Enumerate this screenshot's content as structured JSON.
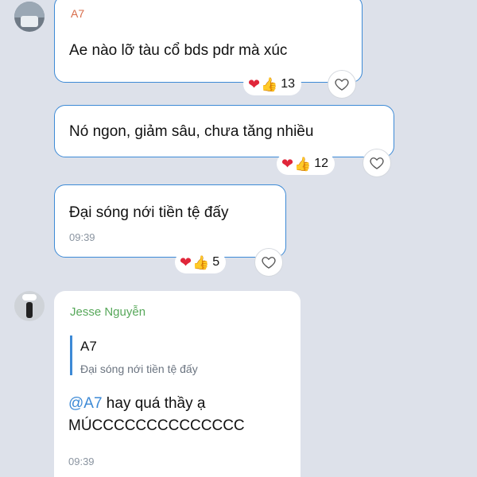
{
  "messages": [
    {
      "sender": "A7",
      "text": "Ae nào lỡ tàu cổ bds pdr mà xúc",
      "reactions": {
        "heart": "❤",
        "thumb": "👍",
        "count": "13"
      }
    },
    {
      "text": "Nó ngon, giảm sâu, chưa tăng nhiều",
      "reactions": {
        "heart": "❤",
        "thumb": "👍",
        "count": "12"
      }
    },
    {
      "text": "Đại sóng nới tiền tệ đấy",
      "time": "09:39",
      "reactions": {
        "heart": "❤",
        "thumb": "👍",
        "count": "5"
      }
    },
    {
      "sender": "Jesse Nguyễn",
      "quote": {
        "sender": "A7",
        "text": "Đại sóng nới tiền tệ đấy"
      },
      "mention": "@A7",
      "text_line1": " hay quá thầy ạ",
      "text_line2": "MÚCCCCCCCCCCCCCC",
      "time": "09:39"
    }
  ],
  "icons": {
    "heart_outline": "heart-outline-icon"
  },
  "colors": {
    "accent": "#3d8ad6",
    "sender_a7": "#d86c4a",
    "sender_jesse": "#57a85a",
    "background": "#dde1ea"
  }
}
